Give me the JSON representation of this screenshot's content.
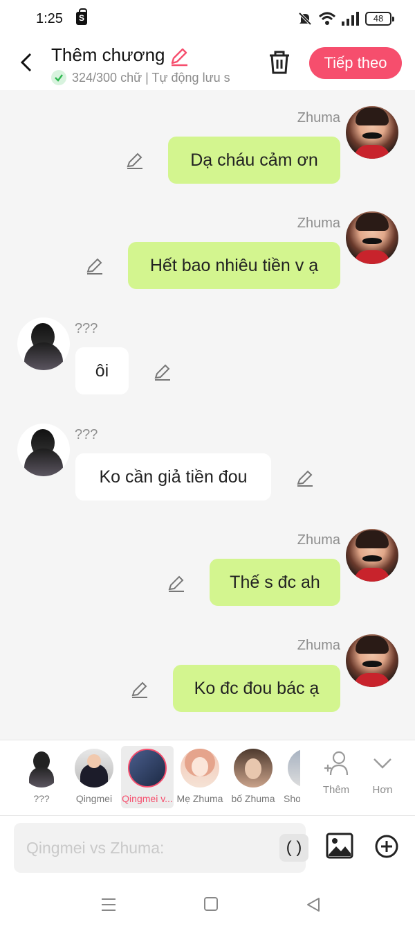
{
  "status_bar": {
    "time": "1:25",
    "shop_icon_letter": "S",
    "battery": "48"
  },
  "header": {
    "title": "Thêm chương",
    "word_count": "324/300 chữ | Tự động lưu s",
    "next_label": "Tiếp theo",
    "accent": "#f64e6d"
  },
  "messages": [
    {
      "sender": "Zhuma",
      "side": "right",
      "text": "Dạ cháu cảm ơn"
    },
    {
      "sender": "Zhuma",
      "side": "right",
      "text": "Hết bao nhiêu tiền v ạ"
    },
    {
      "sender": "???",
      "side": "left",
      "text": "ôi"
    },
    {
      "sender": "???",
      "side": "left",
      "text": "Ko cần giả tiền đou"
    },
    {
      "sender": "Zhuma",
      "side": "right",
      "text": "Thế s đc ah"
    },
    {
      "sender": "Zhuma",
      "side": "right",
      "text": "Ko đc đou bác ạ"
    }
  ],
  "characters": [
    {
      "label": "???",
      "selected": false
    },
    {
      "label": "Qingmei",
      "selected": false
    },
    {
      "label": "Qingmei v...",
      "selected": true
    },
    {
      "label": "Mẹ Zhuma",
      "selected": false
    },
    {
      "label": "bố Zhuma",
      "selected": false
    },
    {
      "label": "Sho",
      "selected": false
    }
  ],
  "strip_actions": {
    "add_label": "Thêm",
    "more_label": "Hơn"
  },
  "composer": {
    "placeholder": "Qingmei vs Zhuma:",
    "paren_label": "( )"
  },
  "colors": {
    "bubble_me": "#d3f58f",
    "bubble_other": "#ffffff",
    "background": "#f5f5f5"
  }
}
